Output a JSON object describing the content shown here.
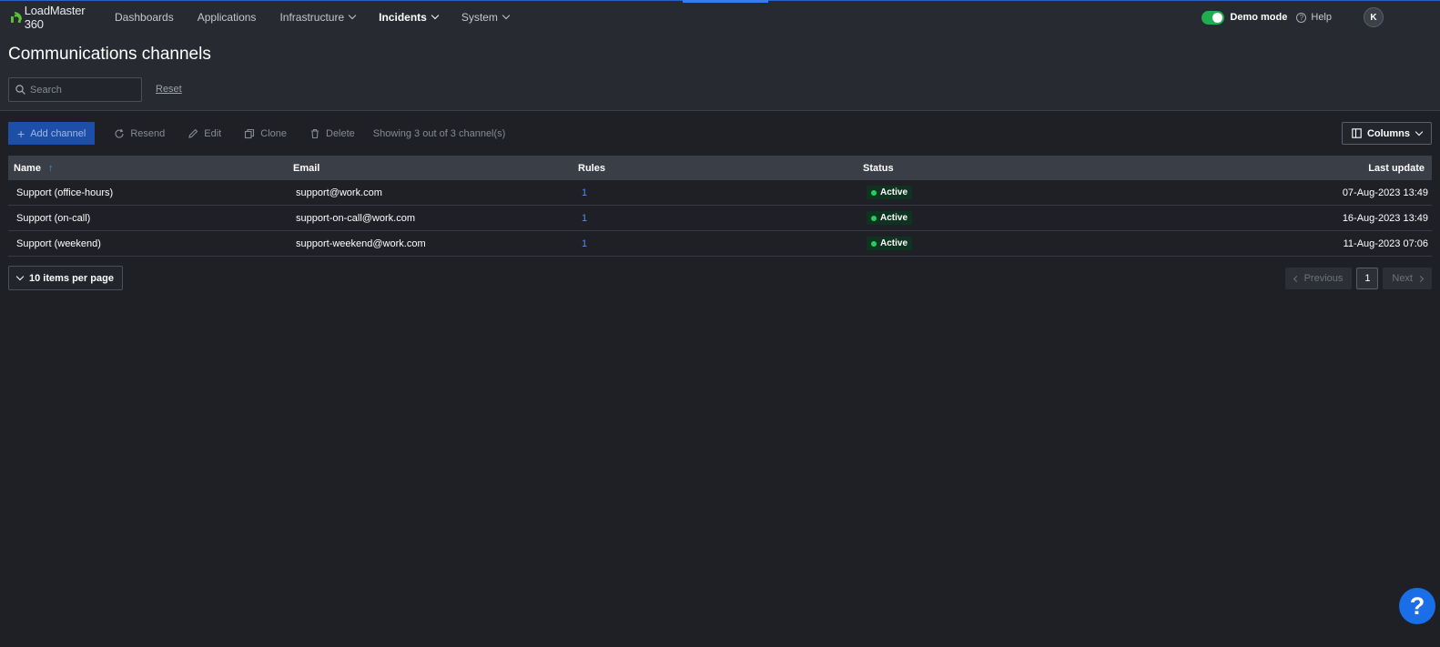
{
  "app": {
    "name": "LoadMaster 360",
    "brand_color": "#5bc236"
  },
  "nav": {
    "items": [
      {
        "label": "Dashboards",
        "has_dropdown": false,
        "active": false
      },
      {
        "label": "Applications",
        "has_dropdown": false,
        "active": false
      },
      {
        "label": "Infrastructure",
        "has_dropdown": true,
        "active": false
      },
      {
        "label": "Incidents",
        "has_dropdown": true,
        "active": true
      },
      {
        "label": "System",
        "has_dropdown": true,
        "active": false
      }
    ]
  },
  "topbar": {
    "demo_mode_label": "Demo mode",
    "demo_mode_on": true,
    "help_label": "Help",
    "avatar_initial": "K"
  },
  "page": {
    "title": "Communications channels",
    "search_placeholder": "Search",
    "reset_label": "Reset"
  },
  "toolbar": {
    "add_label": "Add channel",
    "resend_label": "Resend",
    "edit_label": "Edit",
    "clone_label": "Clone",
    "delete_label": "Delete",
    "showing_text": "Showing 3 out of 3 channel(s)",
    "columns_label": "Columns"
  },
  "table": {
    "headers": {
      "name": "Name",
      "email": "Email",
      "rules": "Rules",
      "status": "Status",
      "last_update": "Last update"
    },
    "sort_indicator": "↑",
    "rows": [
      {
        "name": "Support (office-hours)",
        "email": "support@work.com",
        "rules": "1",
        "status": "Active",
        "last_update": "07-Aug-2023 13:49"
      },
      {
        "name": "Support (on-call)",
        "email": "support-on-call@work.com",
        "rules": "1",
        "status": "Active",
        "last_update": "16-Aug-2023 13:49"
      },
      {
        "name": "Support (weekend)",
        "email": "support-weekend@work.com",
        "rules": "1",
        "status": "Active",
        "last_update": "11-Aug-2023 07:06"
      }
    ]
  },
  "pagination": {
    "per_page_label": "10 items per page",
    "previous_label": "Previous",
    "current_page": "1",
    "next_label": "Next"
  },
  "fab": {
    "label": "?"
  },
  "colors": {
    "accent": "#1a6fe8",
    "status_active": "#1fd35a",
    "primary_button": "#1e4fa8"
  }
}
